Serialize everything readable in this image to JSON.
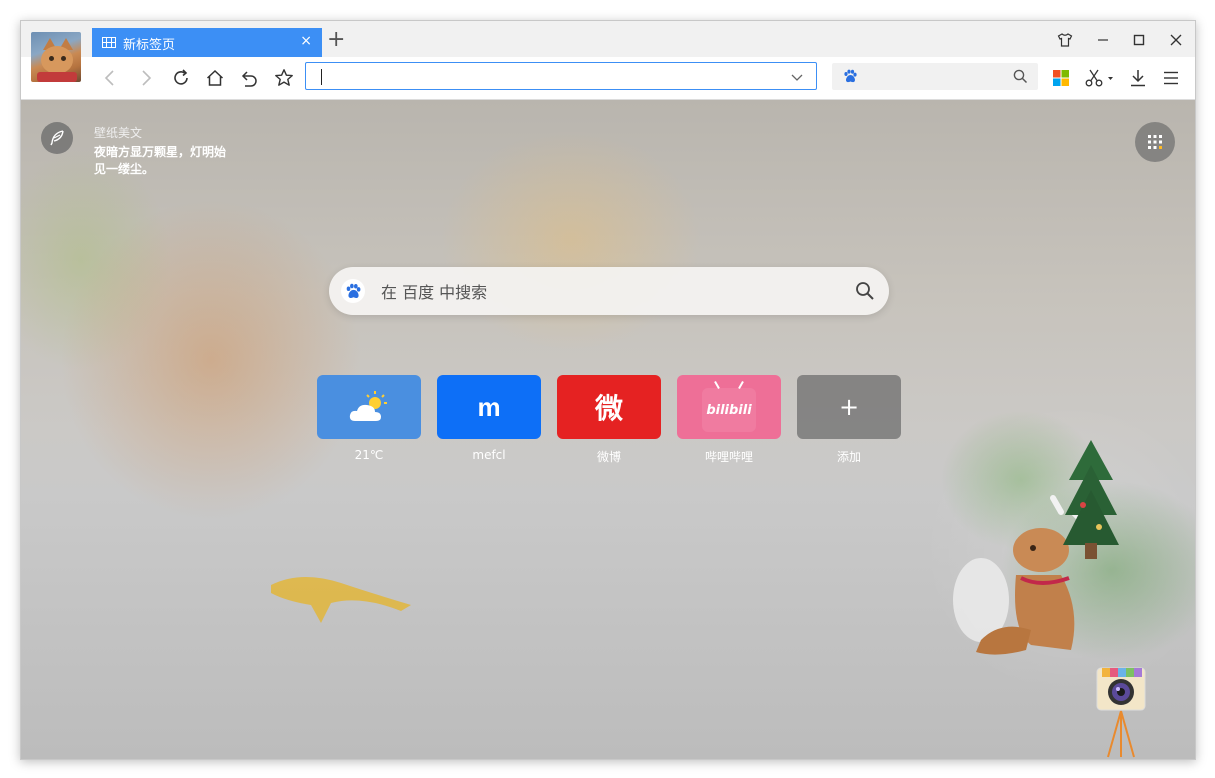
{
  "tab": {
    "title": "新标签页",
    "close": "×"
  },
  "newtab": "+",
  "address": {
    "value": "",
    "placeholder": ""
  },
  "search_engine_box": {
    "placeholder": ""
  },
  "wallpaper": {
    "title": "壁纸美文",
    "text": "夜暗方显万颗星，灯明始见一缕尘。"
  },
  "main_search": {
    "placeholder": "在 百度 中搜索"
  },
  "tiles": [
    {
      "label": "21℃",
      "color": "#4a8fe0"
    },
    {
      "label": "mefcl",
      "glyph": "m",
      "color": "#0d6ff7"
    },
    {
      "label": "微博",
      "glyph": "微",
      "color": "#e52222"
    },
    {
      "label": "哔哩哔哩",
      "glyph": "bilibili",
      "color": "#ee6f97"
    },
    {
      "label": "添加",
      "glyph": "+",
      "color": "#7d7d7d"
    }
  ]
}
